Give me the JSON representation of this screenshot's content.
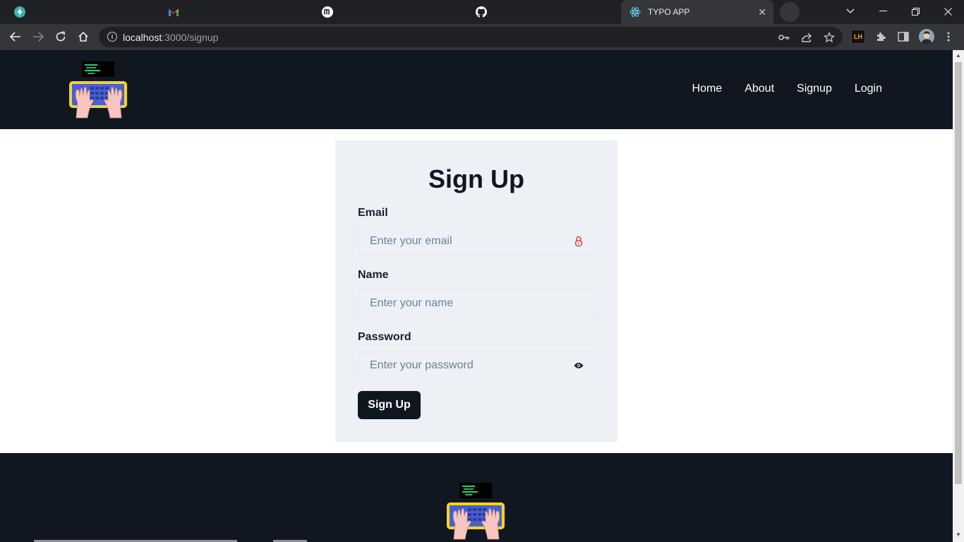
{
  "browser": {
    "tabs": [
      {
        "title": "",
        "icon": "bolt-icon"
      },
      {
        "title": "",
        "icon": "gmail-icon"
      },
      {
        "title": "",
        "icon": "m-logo-icon"
      },
      {
        "title": "",
        "icon": "github-icon"
      },
      {
        "title": "TYPO APP",
        "icon": "react-icon",
        "active": true
      }
    ],
    "window_controls": [
      "chevron-down-icon",
      "minimize-icon",
      "restore-icon",
      "close-icon"
    ],
    "url_host": "localhost",
    "url_path": ":3000/signup",
    "extensions": {
      "lh_label": "LH"
    }
  },
  "site": {
    "nav": {
      "home": "Home",
      "about": "About",
      "signup": "Signup",
      "login": "Login"
    }
  },
  "form": {
    "title": "Sign Up",
    "email": {
      "label": "Email",
      "placeholder": "Enter your email",
      "value": ""
    },
    "name": {
      "label": "Name",
      "placeholder": "Enter your name",
      "value": ""
    },
    "password": {
      "label": "Password",
      "placeholder": "Enter your password",
      "value": ""
    },
    "submit_label": "Sign Up"
  },
  "colors": {
    "header_bg": "#111721",
    "card_bg": "#edf1f5",
    "button_bg": "#111721",
    "lock_icon": "#e53e3e",
    "logo_keyboard_frame": "#f7d51d",
    "logo_keys": "#4a5fd0"
  }
}
